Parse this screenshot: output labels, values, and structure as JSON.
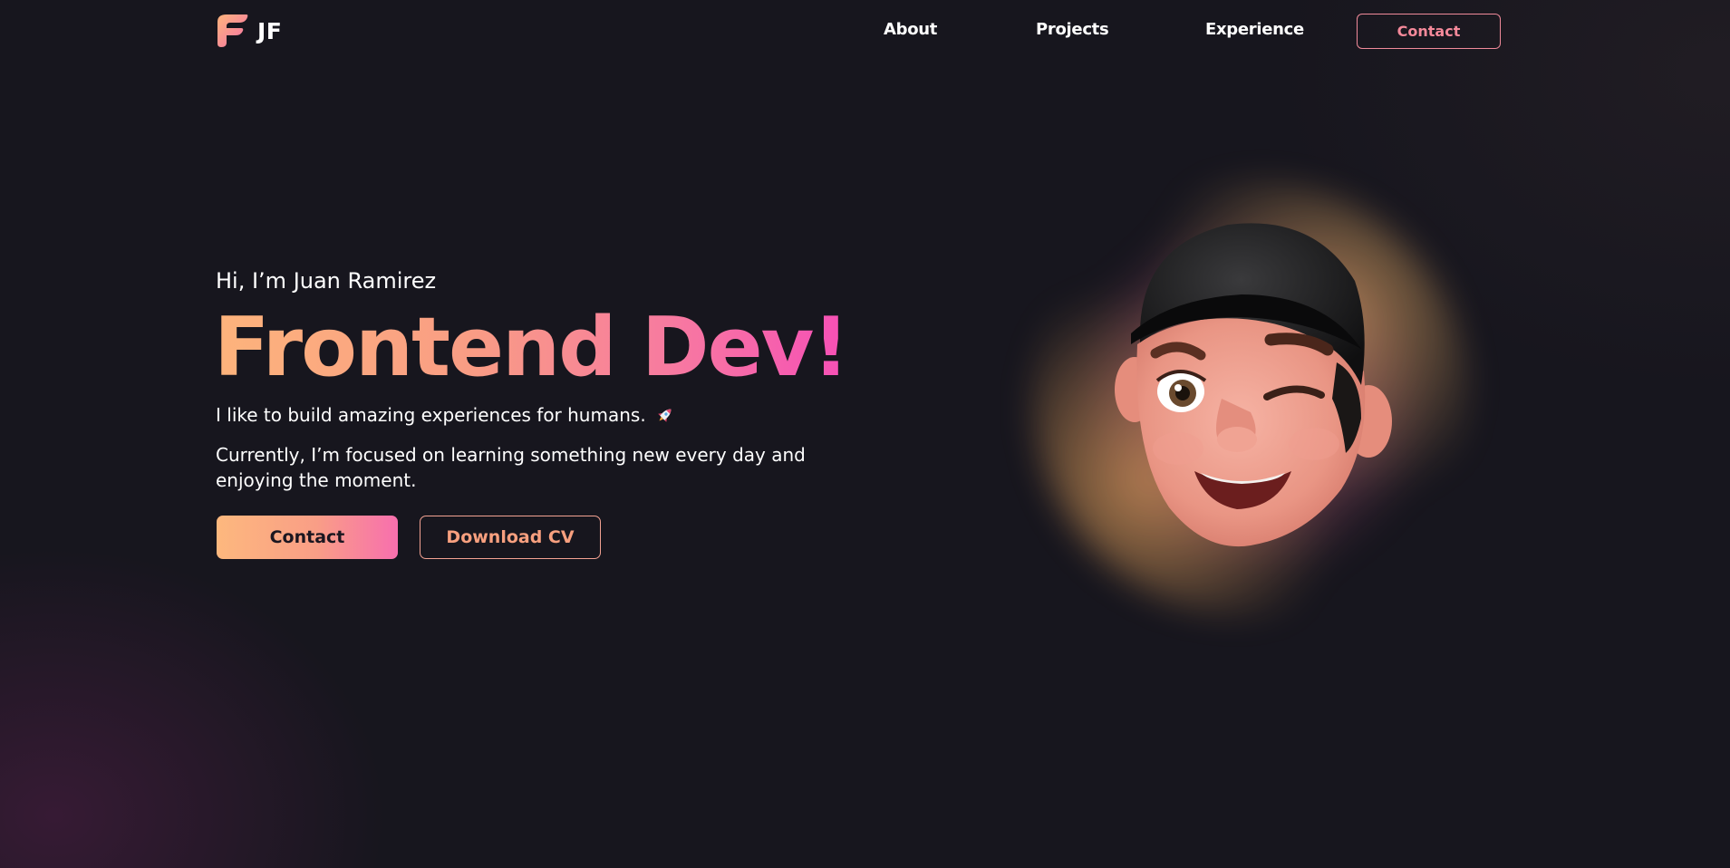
{
  "header": {
    "brand_text": "JF",
    "nav": {
      "about": "About",
      "projects": "Projects",
      "experience": "Experience",
      "contact": "Contact"
    }
  },
  "hero": {
    "greeting": "Hi, I’m Juan Ramirez",
    "headline": "Frontend Dev!",
    "tagline": "I like to build amazing experiences for humans.",
    "focus": "Currently, I’m focused on learning something new every day and enjoying the moment.",
    "contact_button": "Contact",
    "cv_button": "Download CV"
  },
  "icons": {
    "brand": "jf-logo-icon",
    "tagline": "rocket-icon",
    "avatar": "winking-memoji-avatar"
  },
  "colors": {
    "background": "#17161e",
    "accent_start": "#fdb47c",
    "accent_end": "#f64fb6",
    "contact_outline": "#f08a9a",
    "text": "#ffffff"
  }
}
